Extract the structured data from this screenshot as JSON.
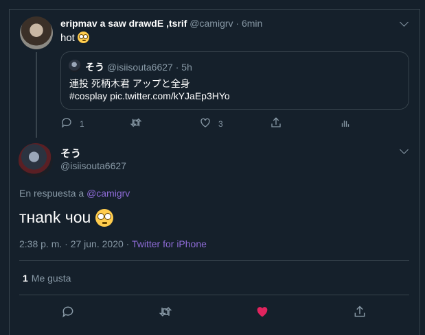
{
  "parent_tweet": {
    "display_name": "eripmav a saw drawdE ,tsrif",
    "handle": "@camigrv",
    "separator": "·",
    "time": "6min",
    "text": "hot",
    "emoji": "flushed-face",
    "reply_count": "1",
    "like_count": "3"
  },
  "quoted_tweet": {
    "display_name": "そう",
    "handle": "@isiisouta6627",
    "separator": "·",
    "time": "5h",
    "line1": "連投 死柄木君 アップと全身",
    "line2": "#cosplay pic.twitter.com/kYJaEp3HYo"
  },
  "main_tweet": {
    "display_name": "そう",
    "handle": "@isiisouta6627",
    "reply_prefix": "En respuesta a",
    "reply_to": "@camigrv",
    "text": "тнank чou",
    "emoji": "flushed-face",
    "timestamp": "2:38 p. m. · 27 jun. 2020 ·",
    "source": "Twitter for iPhone",
    "likes_count": "1",
    "likes_label": "Me gusta",
    "liked": true
  },
  "colors": {
    "background": "#15202b",
    "border": "#38444d",
    "muted": "#8899a6",
    "accent": "#8f6cd8",
    "like_active": "#e0245e"
  }
}
